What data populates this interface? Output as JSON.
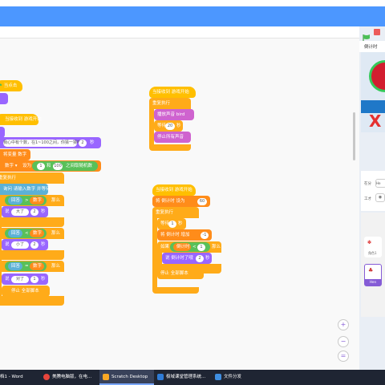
{
  "stage": {
    "title": "倒计时",
    "sprite_x_label": "在分",
    "sprite_y_label": "工才",
    "sprite_name": "Hen",
    "sprite_prop_value": "He",
    "sprite_thumb_label": "角色1",
    "stage_label": "背景"
  },
  "left_script": {
    "hat_label": "当点击",
    "broadcast_hat": "当接收到 游戏开始",
    "say_text": "我心中有个数，在1~100之间，你猜一猜吧",
    "say_secs": "2",
    "set_var": "将变量 数字",
    "set_to": "设为",
    "rand_from": "1",
    "rand_to": "100",
    "rand_label": "之间取随机数",
    "forever": "重复执行",
    "ask": "询问 请输入数字 并等待",
    "if_answer": "回答",
    "cmp1": "数字",
    "then": "那么",
    "say_big": "大了",
    "say_small": "小了",
    "say_right": "对了",
    "secs": "2",
    "secs1": "1",
    "stop_all": "停止 全部脚本"
  },
  "mid_script": {
    "hat": "当接收到 游戏开始",
    "forever": "重复执行",
    "play_sound": "播放声音 bird",
    "wait": "等待",
    "wait_secs": "20",
    "stop_sounds": "停止所有声音"
  },
  "right_script": {
    "hat": "当接收到 游戏开始",
    "set_var": "将 倒计时 设为",
    "set_val": "60",
    "forever": "重复执行",
    "wait": "等待",
    "wait_secs": "1",
    "change": "将 倒计时 增加",
    "change_val": "-1",
    "if_label": "如果",
    "cond_var": "倒计时",
    "cond_val": "1",
    "then": "那么",
    "say": "说 倒计时了哦",
    "say_secs": "2",
    "stop": "停止 全部脚本"
  },
  "zoom": {
    "in": "+",
    "out": "−",
    "reset": "="
  },
  "taskbar": {
    "word": "档1 - Word",
    "chrome": "美腾电脑版，在电...",
    "scratch": "Scratch Desktop",
    "class": "极域课堂管理系统...",
    "share": "文件分发"
  },
  "colors": {
    "menubar": "#4C97FF",
    "control": "#FFAB19",
    "event": "#FFBF00",
    "sound": "#CF63CF",
    "looks": "#9966FF",
    "data": "#FF8C1A",
    "operator": "#59C059",
    "sensing": "#5CB1D6"
  }
}
